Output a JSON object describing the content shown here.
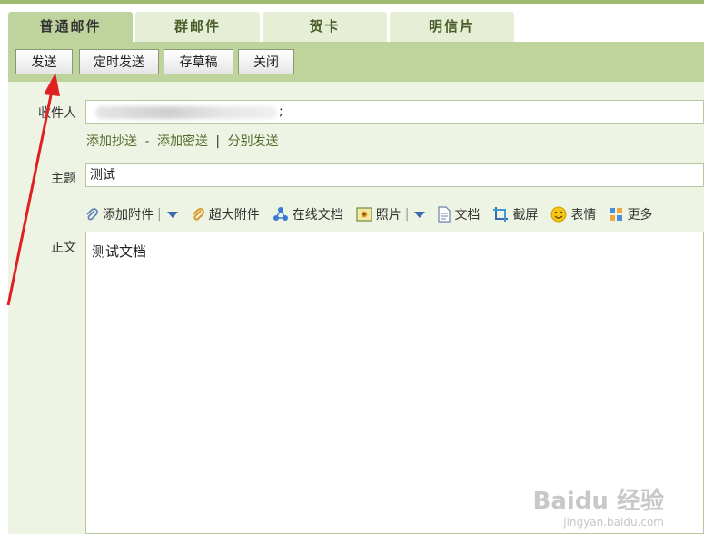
{
  "tabs": [
    {
      "label": "普通邮件",
      "active": true
    },
    {
      "label": "群邮件"
    },
    {
      "label": "贺卡"
    },
    {
      "label": "明信片"
    }
  ],
  "toolbar": {
    "send": "发送",
    "scheduled_send": "定时发送",
    "save_draft": "存草稿",
    "close": "关闭"
  },
  "form": {
    "to_label": "收件人",
    "to_value": ";",
    "add_cc": "添加抄送",
    "link_sep": "-",
    "add_bcc": "添加密送",
    "bar": "|",
    "separate_send": "分别发送",
    "subject_label": "主题",
    "subject_value": "测试",
    "body_label": "正文",
    "body_value": "测试文档"
  },
  "attach_bar": [
    {
      "label": "添加附件",
      "icon": "paperclip-icon",
      "dropdown": true
    },
    {
      "label": "超大附件",
      "icon": "large-attachment-icon"
    },
    {
      "label": "在线文档",
      "icon": "online-doc-icon"
    },
    {
      "label": "照片",
      "icon": "photo-icon",
      "dropdown": true
    },
    {
      "label": "文档",
      "icon": "document-icon"
    },
    {
      "label": "截屏",
      "icon": "screenshot-icon"
    },
    {
      "label": "表情",
      "icon": "smiley-icon"
    },
    {
      "label": "更多",
      "icon": "more-icon"
    }
  ],
  "watermark": {
    "brand": "Baidu 经验",
    "url": "jingyan.baidu.com"
  },
  "colors": {
    "toolbar": "#bfd49c",
    "form_bg": "#eef4e3",
    "arrow": "#e02020"
  }
}
